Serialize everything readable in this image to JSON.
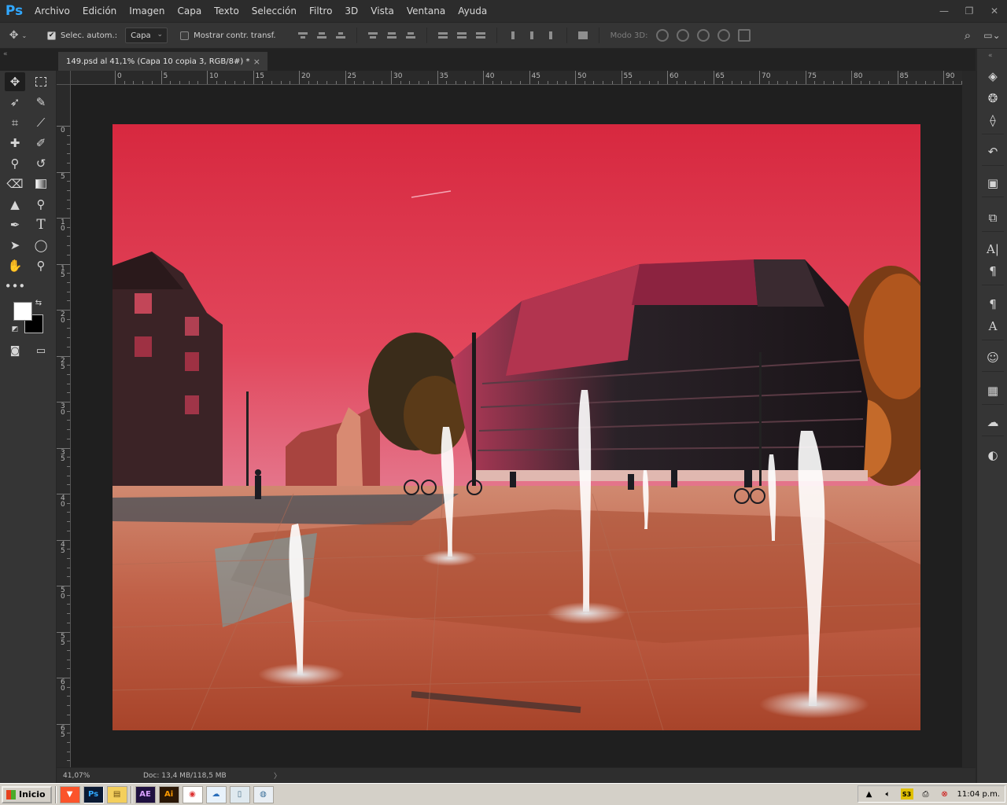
{
  "app": {
    "logo": "Ps"
  },
  "menu": [
    "Archivo",
    "Edición",
    "Imagen",
    "Capa",
    "Texto",
    "Selección",
    "Filtro",
    "3D",
    "Vista",
    "Ventana",
    "Ayuda"
  ],
  "window_controls": {
    "minimize": "—",
    "restore": "❐",
    "close": "✕"
  },
  "options": {
    "auto_select_label": "Selec. autom.:",
    "auto_select_checked": true,
    "layer_mode": "Capa",
    "show_transform_label": "Mostrar contr. transf.",
    "show_transform_checked": false,
    "mode_3d_label": "Modo 3D:"
  },
  "document": {
    "tab_title": "149.psd al 41,1% (Capa 10 copia 3, RGB/8#) *",
    "close_glyph": "×"
  },
  "ruler_h_labels": [
    "0",
    "5",
    "10",
    "15",
    "20",
    "25",
    "30",
    "35",
    "40",
    "45",
    "50",
    "55",
    "60",
    "65",
    "70",
    "75",
    "80",
    "85",
    "90"
  ],
  "ruler_v_labels": [
    "0",
    "5",
    "1 0",
    "1 5",
    "2 0",
    "2 5",
    "3 0",
    "3 5",
    "4 0",
    "4 5",
    "5 0",
    "5 5",
    "6 0",
    "6 5"
  ],
  "status": {
    "zoom": "41,07%",
    "doc_size": "Doc: 13,4 MB/118,5 MB",
    "arrow": "〉"
  },
  "taskbar": {
    "start_label": "Inicio",
    "apps": [
      "brave-icon",
      "photoshop-icon",
      "explorer-icon",
      "after-effects-icon",
      "illustrator-icon",
      "chrome-icon",
      "cloud-icon",
      "notepad-icon",
      "paint-icon"
    ],
    "app_labels": {
      "ps": "Ps",
      "ae": "AE",
      "ai": "Ai"
    },
    "tray_icons": [
      "tray-expand-icon",
      "volume-icon",
      "tray-app-icon",
      "network-icon",
      "security-icon"
    ],
    "clock": "11:04 p.m."
  },
  "colors": {
    "accent": "#31a8ff",
    "sky": "#d7344a",
    "ground": "#c46a4e",
    "foreground_swatch": "#ffffff",
    "background_swatch": "#000000"
  }
}
